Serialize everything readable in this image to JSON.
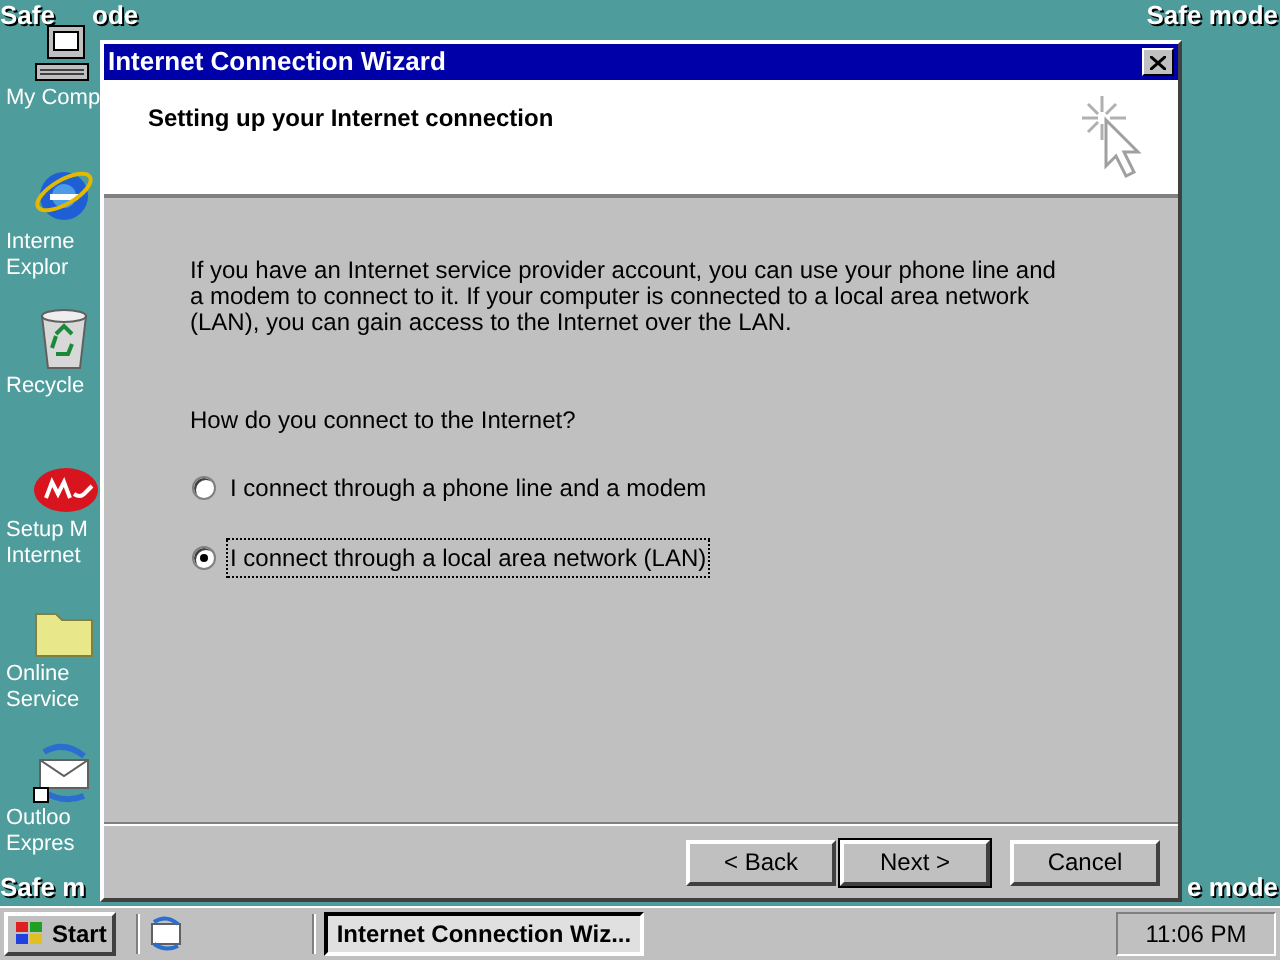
{
  "desktop": {
    "safe_mode": {
      "top_left": "Safe",
      "top_left_rest": "ode",
      "top_right": "Safe mode",
      "bottom_left": "Safe m",
      "bottom_right": "e mode"
    },
    "icons": [
      {
        "kind": "computer",
        "label": [
          "My Comp"
        ]
      },
      {
        "kind": "browser",
        "label": [
          "Interne",
          "Explor"
        ]
      },
      {
        "kind": "recycle",
        "label": [
          "Recycle"
        ]
      },
      {
        "kind": "msn",
        "label": [
          "Setup M",
          "Internet"
        ]
      },
      {
        "kind": "folder",
        "label": [
          "Online",
          "Service"
        ]
      },
      {
        "kind": "mail",
        "label": [
          "Outloo",
          "Expres"
        ]
      }
    ]
  },
  "window": {
    "title": "Internet Connection Wizard",
    "heading": "Setting up your Internet connection",
    "intro": "If you have an Internet service provider account, you can use your phone line and a modem to connect to it. If your computer is connected to a local area network (LAN), you can gain access to the Internet over the LAN.",
    "question": "How do you connect to the Internet?",
    "options": [
      {
        "label": "I connect through a phone line and a modem",
        "selected": false
      },
      {
        "label": "I connect through a local area network (LAN)",
        "selected": true
      }
    ],
    "buttons": [
      {
        "label": "< Back",
        "default": false
      },
      {
        "label": "Next >",
        "default": true
      },
      {
        "label": "Cancel",
        "default": false
      }
    ]
  },
  "taskbar": {
    "start": "Start",
    "tasks": [
      {
        "label": "Internet Connection Wiz...",
        "selected": true
      }
    ],
    "clock": "11:06 PM"
  }
}
